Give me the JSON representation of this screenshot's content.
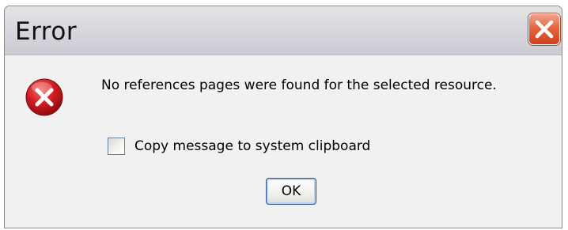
{
  "window": {
    "title": "Error",
    "close_icon": "close-x-icon"
  },
  "message": {
    "icon": "error-icon",
    "text": "No references pages were found for the selected resource."
  },
  "clipboard_option": {
    "label": "Copy message to system clipboard",
    "checked": false
  },
  "buttons": {
    "ok_label": "OK"
  },
  "colors": {
    "error_red": "#c4141a",
    "close_button": "#e5673f"
  }
}
